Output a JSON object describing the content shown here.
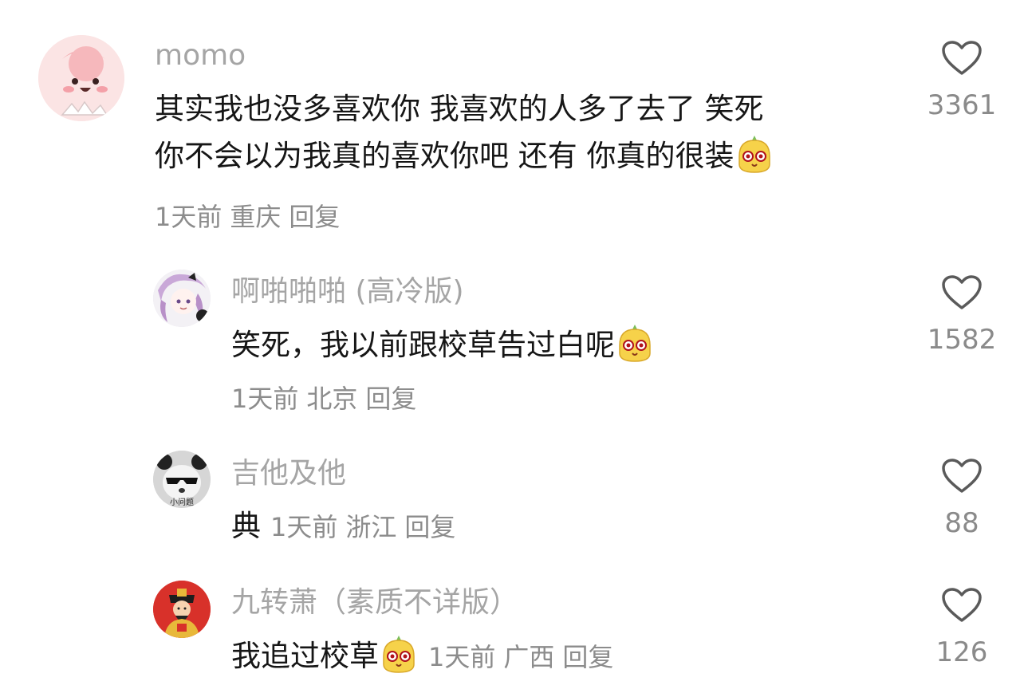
{
  "comments": [
    {
      "username": "momo",
      "lines": [
        "其实我也没多喜欢你 我喜欢的人多了去了 笑死",
        "你不会以为我真的喜欢你吧 还有 你真的很装"
      ],
      "time": "1天前",
      "location": "重庆",
      "reply": "回复",
      "likes": "3361",
      "avatar_icon": "pink-blob-avatar"
    },
    {
      "username": "啊啪啪啪 (高冷版)",
      "text": "笑死，我以前跟校草告过白呢",
      "time": "1天前",
      "location": "北京",
      "reply": "回复",
      "likes": "1582",
      "avatar_icon": "anime-girl-avatar"
    },
    {
      "username": "吉他及他",
      "text": "典",
      "time": "1天前",
      "location": "浙江",
      "reply": "回复",
      "likes": "88",
      "avatar_icon": "panda-sunglasses-avatar",
      "avatar_text": "小问题"
    },
    {
      "username": "九转萧（素质不详版）",
      "text": "我追过校草",
      "time": "1天前",
      "location": "广西",
      "reply": "回复",
      "likes": "126",
      "avatar_icon": "god-of-wealth-avatar"
    }
  ],
  "emoji_name": "smirk-bun-emoji",
  "colors": {
    "username": "#a5a5a5",
    "meta": "#8c8c8c",
    "text": "#161616",
    "like_icon": "#5a5a5a"
  }
}
